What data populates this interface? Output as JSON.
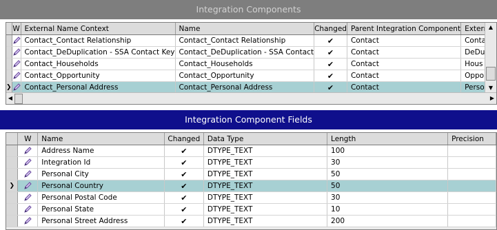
{
  "integration_components": {
    "title": "Integration Components",
    "columns": [
      "W",
      "External Name Context",
      "Name",
      "Changed",
      "Parent Integration Component",
      "Extern"
    ],
    "rows": [
      {
        "external": "Contact_Contact Relationship",
        "name": "Contact_Contact Relationship",
        "changed": "✔",
        "parent": "Contact",
        "ext": "Conta"
      },
      {
        "external": "Contact_DeDuplication - SSA Contact Key",
        "name": "Contact_DeDuplication - SSA Contact",
        "changed": "✔",
        "parent": "Contact",
        "ext": "DeDu"
      },
      {
        "external": "Contact_Households",
        "name": "Contact_Households",
        "changed": "✔",
        "parent": "Contact",
        "ext": "Hous"
      },
      {
        "external": "Contact_Opportunity",
        "name": "Contact_Opportunity",
        "changed": "✔",
        "parent": "Contact",
        "ext": "Oppo"
      },
      {
        "external": "Contact_Personal Address",
        "name": "Contact_Personal Address",
        "changed": "✔",
        "parent": "Contact",
        "ext": "Perso",
        "selected": true
      }
    ]
  },
  "integration_component_fields": {
    "title": "Integration Component Fields",
    "columns": [
      "W",
      "Name",
      "Changed",
      "Data Type",
      "Length",
      "Precision"
    ],
    "rows": [
      {
        "name": "Address Name",
        "changed": "✔",
        "data_type": "DTYPE_TEXT",
        "length": "100"
      },
      {
        "name": "Integration Id",
        "changed": "✔",
        "data_type": "DTYPE_TEXT",
        "length": "30"
      },
      {
        "name": "Personal City",
        "changed": "✔",
        "data_type": "DTYPE_TEXT",
        "length": "50"
      },
      {
        "name": "Personal Country",
        "changed": "✔",
        "data_type": "DTYPE_TEXT",
        "length": "50",
        "selected": true
      },
      {
        "name": "Personal Postal Code",
        "changed": "✔",
        "data_type": "DTYPE_TEXT",
        "length": "30"
      },
      {
        "name": "Personal State",
        "changed": "✔",
        "data_type": "DTYPE_TEXT",
        "length": "10"
      },
      {
        "name": "Personal Street Address",
        "changed": "✔",
        "data_type": "DTYPE_TEXT",
        "length": "200"
      }
    ]
  },
  "colors": {
    "inactive_title_bg": "#7e7e7e",
    "active_title_bg": "#0f0f8c",
    "selected_row_bg": "#a7d0d3"
  },
  "icons": {
    "edit": "pencil-icon",
    "row_pointer": "row-pointer-icon",
    "checkmark": "checkmark-icon"
  },
  "row_pointer_glyph": "❯"
}
